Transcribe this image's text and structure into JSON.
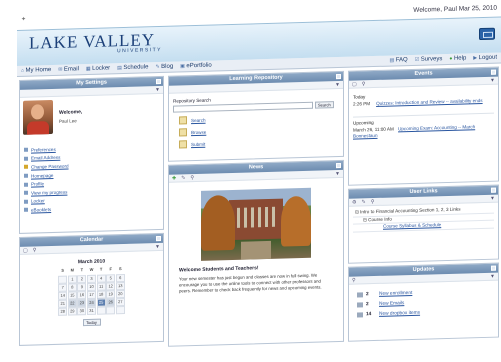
{
  "topbar": {
    "welcome": "Welcome, Paul   Mar 25, 2010"
  },
  "header": {
    "logo_main": "Lake Valley",
    "logo_sub": "UNIVERSITY"
  },
  "nav_left": [
    {
      "label": "My Home"
    },
    {
      "label": "Email"
    },
    {
      "label": "Locker"
    },
    {
      "label": "Schedule"
    },
    {
      "label": "Blog"
    },
    {
      "label": "ePortfolio"
    }
  ],
  "nav_right": [
    {
      "label": "FAQ"
    },
    {
      "label": "Surveys"
    },
    {
      "label": "Help"
    },
    {
      "label": "Logout"
    }
  ],
  "settings": {
    "title": "My Settings",
    "welcome": "Welcome,",
    "name": "Paul Lee",
    "links": [
      {
        "label": "Preferences"
      },
      {
        "label": "Email Address"
      },
      {
        "label": "Change Password"
      },
      {
        "label": "Homepage"
      },
      {
        "label": "Profile"
      },
      {
        "label": "View my progress"
      },
      {
        "label": "Locker"
      },
      {
        "label": "eBooklets"
      }
    ]
  },
  "calendar": {
    "title": "Calendar",
    "month": "March 2010",
    "days": [
      "S",
      "M",
      "T",
      "W",
      "T",
      "F",
      "S"
    ],
    "dates": [
      "",
      "1",
      "2",
      "3",
      "4",
      "5",
      "6",
      "7",
      "8",
      "9",
      "10",
      "11",
      "12",
      "13",
      "14",
      "15",
      "16",
      "17",
      "18",
      "19",
      "20",
      "21",
      "22",
      "23",
      "24",
      "25",
      "26",
      "27",
      "28",
      "29",
      "30",
      "31",
      "",
      "",
      ""
    ],
    "today_button": "Today"
  },
  "repository": {
    "title": "Learning Repository",
    "search_label": "Repository Search",
    "search_button": "Search",
    "items": [
      {
        "label": "Search"
      },
      {
        "label": "Browse"
      },
      {
        "label": "Submit"
      }
    ]
  },
  "news": {
    "title": "News",
    "headline": "Welcome Students and Teachers!",
    "body": "Your new semester has just begun and classes are now in full swing. We encourage you to use the online tools to connect with other professors and peers. Remember to check back frequently for news and upcoming events."
  },
  "events": {
    "title": "Events",
    "today_label": "Today",
    "today_items": [
      {
        "time": "2:26 PM",
        "title": "Quizzes: Introduction and Review -- availability ends"
      }
    ],
    "upcoming_label": "Upcoming",
    "upcoming_items": [
      {
        "time": "March 26, 11:00 AM",
        "title": "Upcoming Exam: Accounting -- March Bonnestaun"
      }
    ]
  },
  "user_links": {
    "title": "User Links",
    "items": [
      {
        "label": "Intro to Financial Accounting Section 1, 2, 3 Links"
      },
      {
        "label": "Course Info"
      },
      {
        "label": "Course Syllabus & Schedule"
      }
    ]
  },
  "updates": {
    "title": "Updates",
    "items": [
      {
        "count": "2",
        "label": "New enrollment"
      },
      {
        "count": "2",
        "label": "New Emails"
      },
      {
        "count": "14",
        "label": "New dropbox items"
      }
    ]
  }
}
